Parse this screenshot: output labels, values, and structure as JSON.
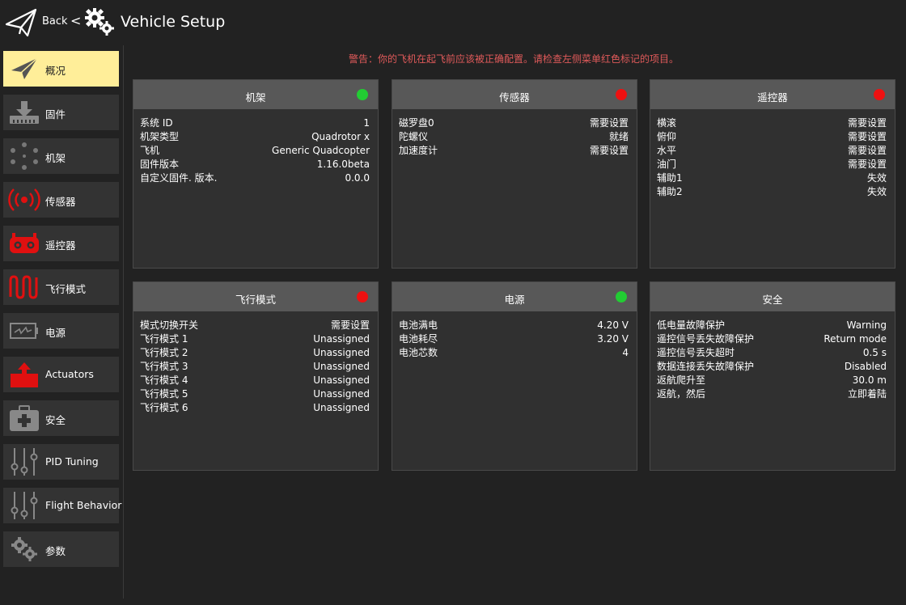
{
  "header": {
    "back_label": "Back",
    "separator": "<",
    "title": "Vehicle Setup"
  },
  "warning": "警告：你的飞机在起飞前应该被正确配置。请检查左侧菜单红色标记的项目。",
  "sidebar": {
    "items": [
      {
        "label": "概况",
        "icon": "paper-plane-icon",
        "active": true
      },
      {
        "label": "固件",
        "icon": "firmware-download-icon"
      },
      {
        "label": "机架",
        "icon": "airframe-icon"
      },
      {
        "label": "传感器",
        "icon": "sensors-icon"
      },
      {
        "label": "遥控器",
        "icon": "radio-controller-icon"
      },
      {
        "label": "飞行模式",
        "icon": "flight-modes-icon"
      },
      {
        "label": "电源",
        "icon": "battery-icon"
      },
      {
        "label": "Actuators",
        "icon": "actuators-icon"
      },
      {
        "label": "安全",
        "icon": "first-aid-icon"
      },
      {
        "label": "PID Tuning",
        "icon": "sliders-icon"
      },
      {
        "label": "Flight Behavior",
        "icon": "sliders-icon"
      },
      {
        "label": "参数",
        "icon": "gears-icon"
      }
    ]
  },
  "cards": {
    "airframe": {
      "title": "机架",
      "status": "green",
      "rows": [
        {
          "k": "系统 ID",
          "v": "1"
        },
        {
          "k": "机架类型",
          "v": "Quadrotor x"
        },
        {
          "k": "飞机",
          "v": "Generic Quadcopter"
        },
        {
          "k": "固件版本",
          "v": "1.16.0beta"
        },
        {
          "k": "自定义固件. 版本.",
          "v": "0.0.0"
        }
      ]
    },
    "sensors": {
      "title": "传感器",
      "status": "red",
      "rows": [
        {
          "k": "磁罗盘0",
          "v": "需要设置"
        },
        {
          "k": "陀螺仪",
          "v": "就绪"
        },
        {
          "k": "加速度计",
          "v": "需要设置"
        }
      ]
    },
    "radio": {
      "title": "遥控器",
      "status": "red",
      "rows": [
        {
          "k": "横滚",
          "v": "需要设置"
        },
        {
          "k": "俯仰",
          "v": "需要设置"
        },
        {
          "k": "水平",
          "v": "需要设置"
        },
        {
          "k": "油门",
          "v": "需要设置"
        },
        {
          "k": "辅助1",
          "v": "失效"
        },
        {
          "k": "辅助2",
          "v": "失效"
        }
      ]
    },
    "flight_modes": {
      "title": "飞行模式",
      "status": "red",
      "rows": [
        {
          "k": "模式切换开关",
          "v": "需要设置"
        },
        {
          "k": "飞行模式 1",
          "v": "Unassigned"
        },
        {
          "k": "飞行模式 2",
          "v": "Unassigned"
        },
        {
          "k": "飞行模式 3",
          "v": "Unassigned"
        },
        {
          "k": "飞行模式 4",
          "v": "Unassigned"
        },
        {
          "k": "飞行模式 5",
          "v": "Unassigned"
        },
        {
          "k": "飞行模式 6",
          "v": "Unassigned"
        }
      ]
    },
    "power": {
      "title": "电源",
      "status": "green",
      "rows": [
        {
          "k": "电池满电",
          "v": "4.20 V"
        },
        {
          "k": "电池耗尽",
          "v": "3.20 V"
        },
        {
          "k": "电池芯数",
          "v": "4"
        }
      ]
    },
    "safety": {
      "title": "安全",
      "rows": [
        {
          "k": "低电量故障保护",
          "v": "Warning"
        },
        {
          "k": "遥控信号丢失故障保护",
          "v": "Return mode"
        },
        {
          "k": "遥控信号丢失超时",
          "v": "0.5 s"
        },
        {
          "k": "数据连接丢失故障保护",
          "v": "Disabled"
        },
        {
          "k": "返航爬升至",
          "v": "30.0 m"
        },
        {
          "k": "返航，然后",
          "v": "立即着陆"
        }
      ]
    }
  },
  "colors": {
    "status_green": "#22cc33",
    "status_red": "#ee1111",
    "active_nav": "#ffee99",
    "warning_text": "#e05a5a"
  }
}
